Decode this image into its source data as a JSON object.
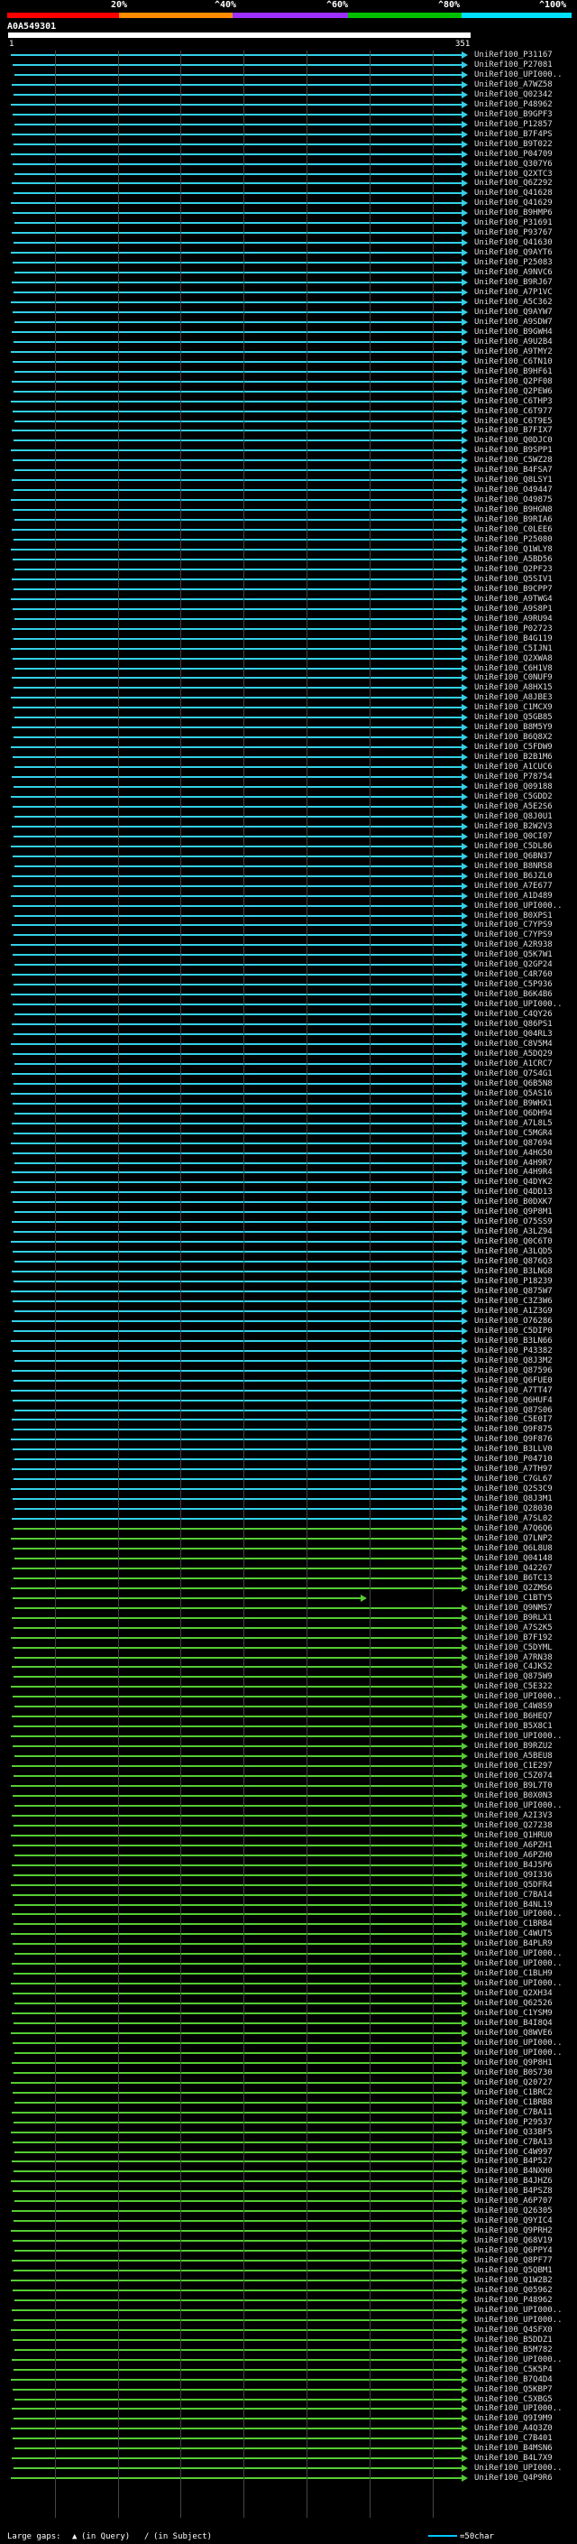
{
  "accession": "A0A549301",
  "scale_ticks": [
    "1",
    "351"
  ],
  "percent_labels": [
    "20%",
    "^40%",
    "^60%",
    "^80%",
    "^100%"
  ],
  "colors": {
    "red": "#ff0000",
    "orange": "#ff8c00",
    "purple": "#9b30ff",
    "green": "#00c000",
    "cyan": "#00e0ff",
    "hit_cyan": "#33d0e8",
    "hit_green": "#55cc33"
  },
  "footer": {
    "gaps_label": "Large gaps:",
    "query_sym": "(in Query)",
    "subject_sym": "(in Subject)",
    "legend_label": "=50char"
  },
  "hits": [
    "UniRef100_P31167",
    "UniRef100_P27081",
    "UniRef100_UPI000..",
    "UniRef100_A7WZ58",
    "UniRef100_Q02342",
    "UniRef100_P48962",
    "UniRef100_B9GPF3",
    "UniRef100_P12857",
    "UniRef100_B7F4PS",
    "UniRef100_B9T022",
    "UniRef100_P04709",
    "UniRef100_Q307Y6",
    "UniRef100_Q2XTC3",
    "UniRef100_Q6Z292",
    "UniRef100_Q41628",
    "UniRef100_Q41629",
    "UniRef100_B9HMP6",
    "UniRef100_P31691",
    "UniRef100_P93767",
    "UniRef100_Q41630",
    "UniRef100_Q9AYT6",
    "UniRef100_P25083",
    "UniRef100_A9NVC6",
    "UniRef100_B9RJ67",
    "UniRef100_A7P1VC",
    "UniRef100_A5C362",
    "UniRef100_Q9AYW7",
    "UniRef100_A9SDW7",
    "UniRef100_B9GWH4",
    "UniRef100_A9U2B4",
    "UniRef100_A9TMY2",
    "UniRef100_C6TN10",
    "UniRef100_B9HF61",
    "UniRef100_Q2PF08",
    "UniRef100_Q2PEW6",
    "UniRef100_C6THP3",
    "UniRef100_C6T977",
    "UniRef100_C6T9E5",
    "UniRef100_B7FIX7",
    "UniRef100_Q0DJC0",
    "UniRef100_B9SPP1",
    "UniRef100_C5WZ28",
    "UniRef100_B4FSA7",
    "UniRef100_Q8LSY1",
    "UniRef100_O49447",
    "UniRef100_O49875",
    "UniRef100_B9HGN8",
    "UniRef100_B9RIA6",
    "UniRef100_C0LEE6",
    "UniRef100_P25080",
    "UniRef100_Q1WLY8",
    "UniRef100_A5BD56",
    "UniRef100_Q2PF23",
    "UniRef100_Q5SIV1",
    "UniRef100_B9CPP7",
    "UniRef100_A9TWG4",
    "UniRef100_A9S8P1",
    "UniRef100_A9RU94",
    "UniRef100_P02723",
    "UniRef100_B4G119",
    "UniRef100_C5IJN1",
    "UniRef100_Q2XWA8",
    "UniRef100_C6H1V8",
    "UniRef100_C0NUF9",
    "UniRef100_A8HX15",
    "UniRef100_A8JBE3",
    "UniRef100_C1MCX9",
    "UniRef100_Q5GB85",
    "UniRef100_B8M5Y9",
    "UniRef100_B6Q8X2",
    "UniRef100_C5FDW9",
    "UniRef100_B2B1M6",
    "UniRef100_A1CUC6",
    "UniRef100_P78754",
    "UniRef100_Q09188",
    "UniRef100_C5GDD2",
    "UniRef100_A5E2S6",
    "UniRef100_Q8J0U1",
    "UniRef100_B2W2V3",
    "UniRef100_Q0CI07",
    "UniRef100_C5DL86",
    "UniRef100_Q6BN37",
    "UniRef100_B8NRS8",
    "UniRef100_B6JZL0",
    "UniRef100_A7E677",
    "UniRef100_A1D489",
    "UniRef100_UPI000..",
    "UniRef100_B0XPS1",
    "UniRef100_C7YPS9",
    "UniRef100_C7YPS9",
    "UniRef100_A2R938",
    "UniRef100_Q5K7W1",
    "UniRef100_Q2GP24",
    "UniRef100_C4R760",
    "UniRef100_C5P936",
    "UniRef100_B6K4B6",
    "UniRef100_UPI000..",
    "UniRef100_C4QY26",
    "UniRef100_Q86PS1",
    "UniRef100_Q04RL3",
    "UniRef100_C8V5M4",
    "UniRef100_A5DQ29",
    "UniRef100_A1CRC7",
    "UniRef100_Q7S4G1",
    "UniRef100_Q6B5N8",
    "UniRef100_Q5AS16",
    "UniRef100_B9WHX1",
    "UniRef100_Q6DH94",
    "UniRef100_A7L8L5",
    "UniRef100_C5MGR4",
    "UniRef100_Q87694",
    "UniRef100_A4HG50",
    "UniRef100_A4H9R7",
    "UniRef100_A4H9R4",
    "UniRef100_Q4DYK2",
    "UniRef100_Q4DD13",
    "UniRef100_B0DXK7",
    "UniRef100_Q9P8M1",
    "UniRef100_O75SS9",
    "UniRef100_A3LZ94",
    "UniRef100_Q0C6T0",
    "UniRef100_A3LQD5",
    "UniRef100_Q876Q3",
    "UniRef100_B3LNG8",
    "UniRef100_P18239",
    "UniRef100_Q875W7",
    "UniRef100_C3Z3W6",
    "UniRef100_A1Z3G9",
    "UniRef100_O76286",
    "UniRef100_C5DIP0",
    "UniRef100_B3LN66",
    "UniRef100_P43382",
    "UniRef100_Q8J3M2",
    "UniRef100_Q87596",
    "UniRef100_Q6FUE0",
    "UniRef100_A7TT47",
    "UniRef100_Q6HUF4",
    "UniRef100_Q87S06",
    "UniRef100_C5E0I7",
    "UniRef100_Q9F875",
    "UniRef100_Q9F876",
    "UniRef100_B3LLV0",
    "UniRef100_P04710",
    "UniRef100_A7TH97",
    "UniRef100_C7GL67",
    "UniRef100_Q2S3C9",
    "UniRef100_Q8J3M1",
    "UniRef100_Q28030",
    "UniRef100_A7SL02",
    "UniRef100_A7Q6Q6",
    "UniRef100_Q7LNP2",
    "UniRef100_Q6L8U8",
    "UniRef100_Q04148",
    "UniRef100_Q42267",
    "UniRef100_B6TC13",
    "UniRef100_Q2ZMS6",
    "UniRef100_C1BTY5",
    "UniRef100_Q9NMS7",
    "UniRef100_B9RLX1",
    "UniRef100_A7S2K5",
    "UniRef100_B7F192",
    "UniRef100_C5DYML",
    "UniRef100_A7RN38",
    "UniRef100_C4JK52",
    "UniRef100_Q875W9",
    "UniRef100_C5E322",
    "UniRef100_UPI000..",
    "UniRef100_C4W8S9",
    "UniRef100_B6HEQ7",
    "UniRef100_B5X8C1",
    "UniRef100_UPI000..",
    "UniRef100_B9RZU2",
    "UniRef100_A5BEU8",
    "UniRef100_C1E297",
    "UniRef100_C5Z074",
    "UniRef100_B9L7T0",
    "UniRef100_B0X0N3",
    "UniRef100_UPI000..",
    "UniRef100_A2I3V3",
    "UniRef100_Q27238",
    "UniRef100_Q1HRU0",
    "UniRef100_A6PZH1",
    "UniRef100_A6PZH0",
    "UniRef100_B4J5P6",
    "UniRef100_Q9I336",
    "UniRef100_Q5DFR4",
    "UniRef100_C7BA14",
    "UniRef100_B4NL19",
    "UniRef100_UPI000..",
    "UniRef100_C1BRB4",
    "UniRef100_C4WUT5",
    "UniRef100_B4PLR9",
    "UniRef100_UPI000..",
    "UniRef100_UPI000..",
    "UniRef100_C1BLH9",
    "UniRef100_UPI000..",
    "UniRef100_Q2XH34",
    "UniRef100_Q62526",
    "UniRef100_C1YSM9",
    "UniRef100_B4I8Q4",
    "UniRef100_Q8WVE6",
    "UniRef100_UPI000..",
    "UniRef100_UPI000..",
    "UniRef100_Q9P8H1",
    "UniRef100_B0S730",
    "UniRef100_Q20727",
    "UniRef100_C1BRC2",
    "UniRef100_C1BRB8",
    "UniRef100_C7BA11",
    "UniRef100_P29537",
    "UniRef100_Q33BF5",
    "UniRef100_C7BA13",
    "UniRef100_C4W997",
    "UniRef100_B4P527",
    "UniRef100_B4NXH0",
    "UniRef100_B4JHZ6",
    "UniRef100_B4PSZ8",
    "UniRef100_A6P707",
    "UniRef100_Q26305",
    "UniRef100_Q9YIC4",
    "UniRef100_Q9PRH2",
    "UniRef100_Q68V19",
    "UniRef100_Q6PPY4",
    "UniRef100_Q8PF77",
    "UniRef100_Q5QBM1",
    "UniRef100_Q1W2B2",
    "UniRef100_Q05962",
    "UniRef100_P48962",
    "UniRef100_UPI000..",
    "UniRef100_UPI000..",
    "UniRef100_Q4SFX0",
    "UniRef100_B5DDZ1",
    "UniRef100_B5M782",
    "UniRef100_UPI000..",
    "UniRef100_C5K5P4",
    "UniRef100_B7Q4D4",
    "UniRef100_Q5KBP7",
    "UniRef100_C5XBG5",
    "UniRef100_UPI000..",
    "UniRef100_Q9I9M9",
    "UniRef100_A4Q3Z0",
    "UniRef100_C7B401",
    "UniRef100_B4MSN6",
    "UniRef100_B4L7X9",
    "UniRef100_UPI000..",
    "UniRef100_Q4P9R6"
  ]
}
